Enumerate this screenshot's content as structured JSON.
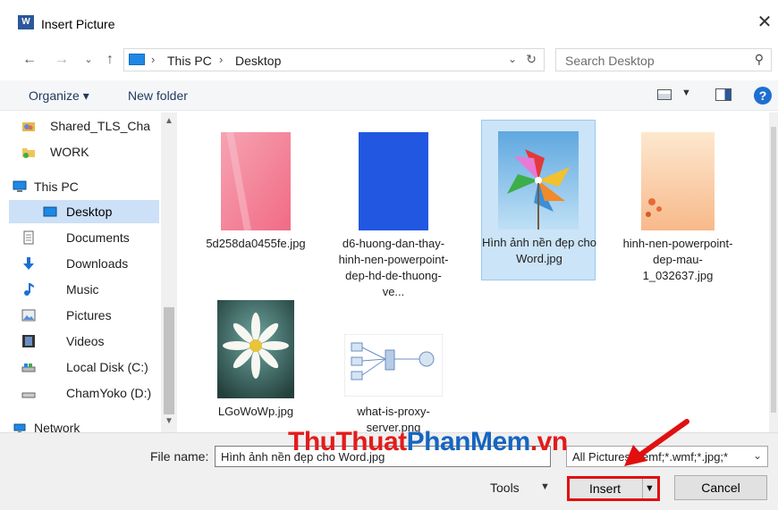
{
  "window": {
    "title": "Insert Picture",
    "close_symbol": "✕"
  },
  "address": {
    "crumbs": [
      "This PC",
      "Desktop"
    ],
    "search_placeholder": "Search Desktop"
  },
  "toolbar": {
    "organize_label": "Organize ▾",
    "new_folder_label": "New folder"
  },
  "sidebar": {
    "items": [
      {
        "label": "Shared_TLS_Cha",
        "icon": "shared-folder-icon"
      },
      {
        "label": "WORK",
        "icon": "folder-icon"
      },
      {
        "label": "This PC",
        "icon": "computer-icon"
      },
      {
        "label": "Desktop",
        "icon": "desktop-icon",
        "selected": true
      },
      {
        "label": "Documents",
        "icon": "documents-icon"
      },
      {
        "label": "Downloads",
        "icon": "download-icon"
      },
      {
        "label": "Music",
        "icon": "music-icon"
      },
      {
        "label": "Pictures",
        "icon": "pictures-icon"
      },
      {
        "label": "Videos",
        "icon": "videos-icon"
      },
      {
        "label": "Local Disk (C:)",
        "icon": "drive-icon"
      },
      {
        "label": "ChamYoko (D:)",
        "icon": "drive-icon"
      },
      {
        "label": "Network",
        "icon": "network-icon"
      }
    ]
  },
  "files": [
    {
      "name": "5d258da0455fe.jpg",
      "kind": "pink-image"
    },
    {
      "name": "d6-huong-dan-thay-hinh-nen-powerpoint-dep-hd-de-thuong-ve...",
      "kind": "blue-image"
    },
    {
      "name": "Hình ảnh nền đẹp cho Word.jpg",
      "kind": "pinwheel-image",
      "selected": true
    },
    {
      "name": "hinh-nen-powerpoint-dep-mau-1_032637.jpg",
      "kind": "peach-image"
    },
    {
      "name": "LGoWoWp.jpg",
      "kind": "daisy-image"
    },
    {
      "name": "what-is-proxy-server.png",
      "kind": "diagram-image"
    }
  ],
  "bottom": {
    "file_name_label": "File name:",
    "file_name_value": "Hình ảnh nền đẹp cho Word.jpg",
    "filter_value": "All Pictures(*.emf;*.wmf;*.jpg;*",
    "tools_label": "Tools",
    "insert_label": "Insert",
    "cancel_label": "Cancel"
  },
  "watermark": {
    "part1": "ThuThuat",
    "part2": "PhanMem",
    "part3": ".vn"
  },
  "colors": {
    "selection": "#cce4f7",
    "highlight_border": "#e01010",
    "accent": "#1e6fd1"
  }
}
